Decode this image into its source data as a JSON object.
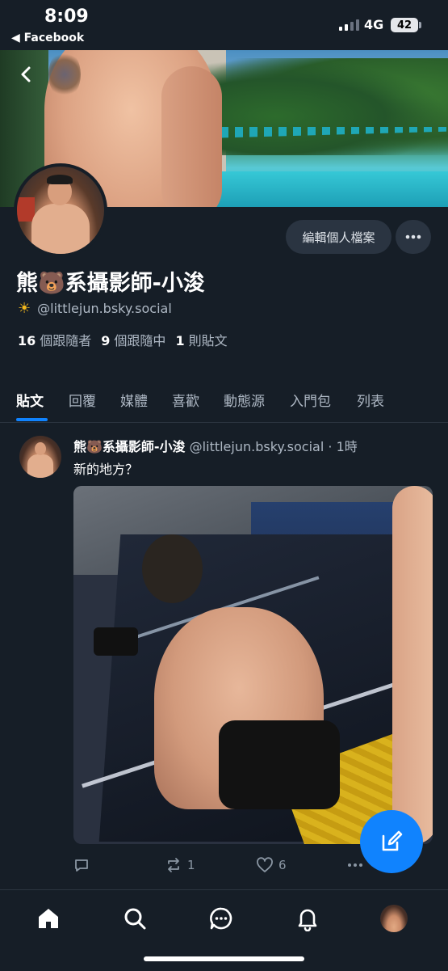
{
  "status_bar": {
    "time": "8:09",
    "back_app": "◀ Facebook",
    "network": "4G",
    "battery": "42"
  },
  "profile": {
    "display_name": "熊🐻系攝影師-小浚",
    "handle_emoji": "☀",
    "handle": "@littlejun.bsky.social",
    "edit_label": "編輯個人檔案",
    "stats": {
      "followers_count": "16",
      "followers_label": "個跟隨者",
      "following_count": "9",
      "following_label": "個跟隨中",
      "posts_count": "1",
      "posts_label": "則貼文"
    }
  },
  "tabs": [
    "貼文",
    "回覆",
    "媒體",
    "喜歡",
    "動態源",
    "入門包",
    "列表"
  ],
  "active_tab": "貼文",
  "post": {
    "author": "熊🐻系攝影師-小浚",
    "handle": "@littlejun.bsky.social",
    "time": "· 1時",
    "text": "新的地方？",
    "reposts": "1",
    "likes": "6"
  },
  "colors": {
    "background": "#161e27",
    "accent": "#1083fe",
    "muted_text": "#aeb8c4"
  },
  "bottom_nav": [
    "home-icon",
    "search-icon",
    "chat-icon",
    "bell-icon",
    "profile-avatar"
  ]
}
